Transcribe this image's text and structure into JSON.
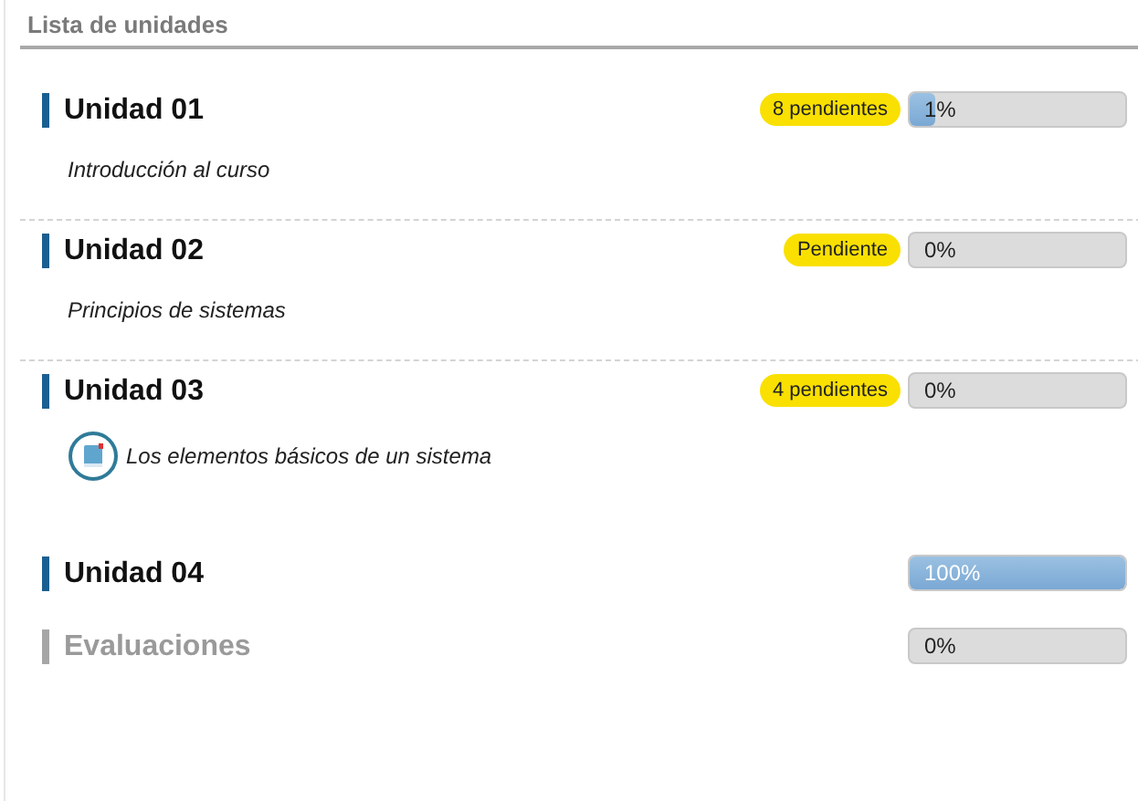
{
  "panel": {
    "title": "Lista de unidades"
  },
  "units": [
    {
      "title": "Unidad 01",
      "disabled": false,
      "divider": true,
      "badge": "8 pendientes",
      "progress": {
        "level": 0.01,
        "reading": "1%"
      },
      "items": [
        {
          "kind": "description",
          "text": "Introducción al curso"
        }
      ]
    },
    {
      "title": "Unidad 02",
      "disabled": false,
      "divider": true,
      "badge": "Pendiente",
      "progress": {
        "reading": "0%"
      },
      "items": [
        {
          "kind": "description",
          "text": "Principios de sistemas"
        }
      ]
    },
    {
      "title": "Unidad 03",
      "disabled": false,
      "divider": false,
      "badge": "4 pendientes",
      "progress": {
        "reading": "0%"
      },
      "items": [
        {
          "kind": "lesson",
          "text": "Los elementos básicos de un sistema"
        }
      ]
    },
    {
      "title": "Unidad 04",
      "disabled": false,
      "divider": false,
      "progress": {
        "level": 1,
        "reading": "100%"
      }
    },
    {
      "title": "Evaluaciones",
      "disabled": true,
      "divider": false,
      "progress": {
        "reading": "0%"
      }
    }
  ]
}
